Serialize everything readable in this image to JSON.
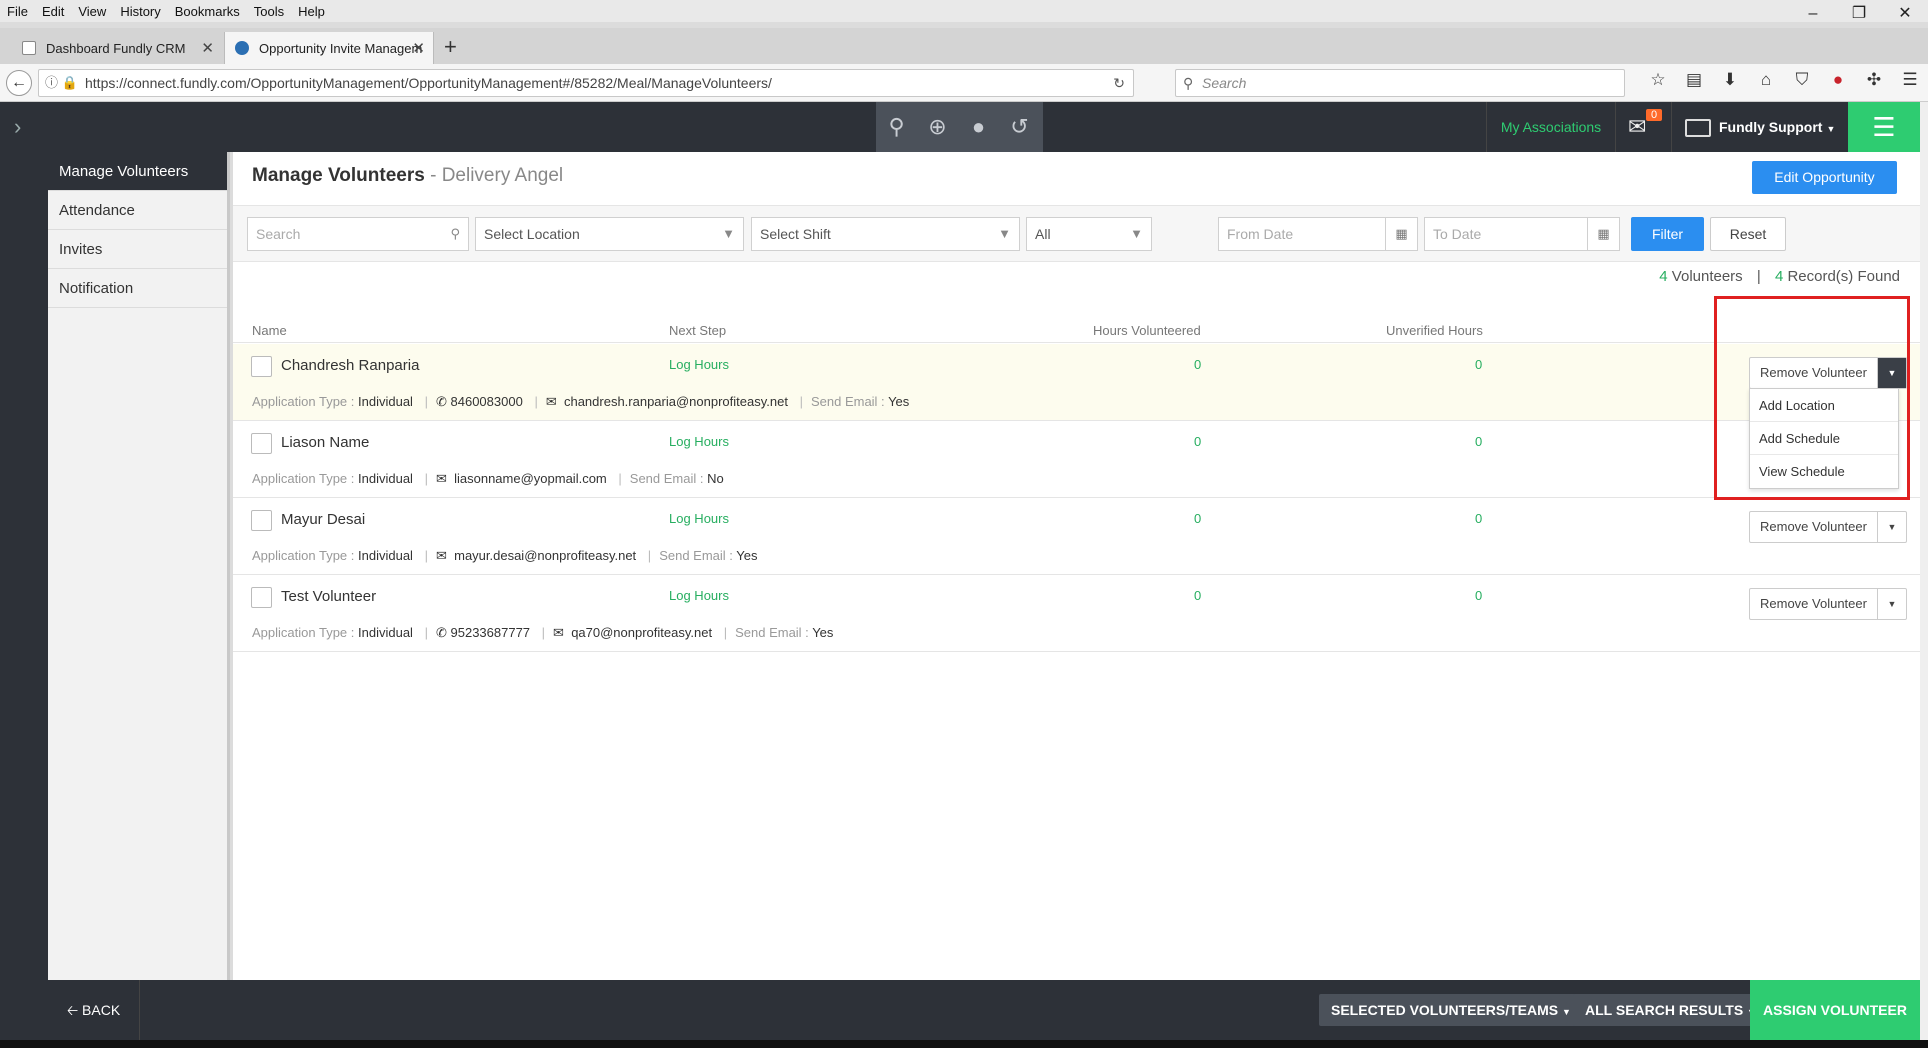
{
  "menubar": [
    "File",
    "Edit",
    "View",
    "History",
    "Bookmarks",
    "Tools",
    "Help"
  ],
  "window_controls": {
    "minimize": "–",
    "restore": "❐",
    "close": "✕"
  },
  "tabs": [
    {
      "title": "Dashboard Fundly CRM"
    },
    {
      "title": "Opportunity Invite Managem"
    }
  ],
  "browser": {
    "url": "https://connect.fundly.com/OpportunityManagement/OpportunityManagement#/85282/Meal/ManageVolunteers/",
    "search_placeholder": "Search"
  },
  "header": {
    "my_associations": "My Associations",
    "mail_badge": "0",
    "user_name": "Fundly Support"
  },
  "sidebar": {
    "items": [
      {
        "label": "Manage Volunteers"
      },
      {
        "label": "Attendance"
      },
      {
        "label": "Invites"
      },
      {
        "label": "Notification"
      }
    ]
  },
  "page": {
    "title": "Manage Volunteers",
    "separator": " - ",
    "subtitle": "Delivery Angel",
    "edit_button": "Edit Opportunity"
  },
  "filters": {
    "search_placeholder": "Search",
    "location": "Select Location",
    "shift": "Select Shift",
    "status": "All",
    "from_date_placeholder": "From Date",
    "to_date_placeholder": "To Date",
    "filter_button": "Filter",
    "reset_button": "Reset"
  },
  "summary": {
    "volunteers_count": "4",
    "volunteers_label": "Volunteers",
    "records_count": "4",
    "records_label": "Record(s) Found"
  },
  "table": {
    "headers": [
      "Name",
      "Next Step",
      "Hours Volunteered",
      "Unverified Hours"
    ],
    "rows": [
      {
        "name": "Chandresh Ranparia",
        "next_step": "Log Hours",
        "hours": "0",
        "unverified": "0",
        "app_type_label": "Application Type :",
        "app_type": "Individual",
        "phone": "8460083000",
        "email": "chandresh.ranparia@nonprofiteasy.net",
        "send_email_label": "Send Email :",
        "send_email": "Yes"
      },
      {
        "name": "Liason Name",
        "next_step": "Log Hours",
        "hours": "0",
        "unverified": "0",
        "app_type_label": "Application Type :",
        "app_type": "Individual",
        "email": "liasonname@yopmail.com",
        "send_email_label": "Send Email :",
        "send_email": "No"
      },
      {
        "name": "Mayur Desai",
        "next_step": "Log Hours",
        "hours": "0",
        "unverified": "0",
        "app_type_label": "Application Type :",
        "app_type": "Individual",
        "email": "mayur.desai@nonprofiteasy.net",
        "send_email_label": "Send Email :",
        "send_email": "Yes"
      },
      {
        "name": "Test Volunteer",
        "next_step": "Log Hours",
        "hours": "0",
        "unverified": "0",
        "app_type_label": "Application Type :",
        "app_type": "Individual",
        "phone": "95233687777",
        "email": "qa70@nonprofiteasy.net",
        "send_email_label": "Send Email :",
        "send_email": "Yes"
      }
    ],
    "row_action": "Remove Volunteer"
  },
  "dropdown_menu": [
    "Add Location",
    "Add Schedule",
    "View Schedule"
  ],
  "footer": {
    "back": "BACK",
    "selected": "SELECTED VOLUNTEERS/TEAMS",
    "all_results": "ALL SEARCH RESULTS",
    "assign": "ASSIGN VOLUNTEER"
  },
  "colors": {
    "accent_green": "#2ecc71",
    "accent_blue": "#2b8ef0",
    "dark": "#2d3138",
    "highlight_red": "#e02020"
  }
}
